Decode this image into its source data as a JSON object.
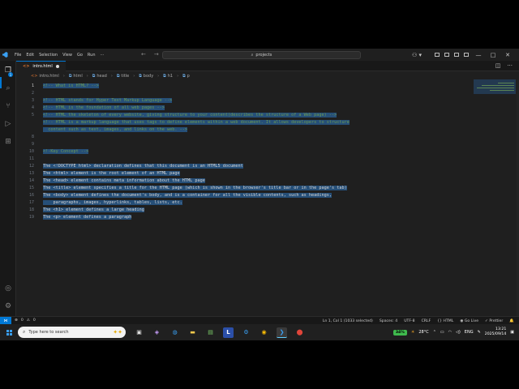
{
  "titlebar": {
    "menu": [
      "File",
      "Edit",
      "Selection",
      "View",
      "Go",
      "Run"
    ],
    "menu_more": "···",
    "search_text": "projects",
    "win_controls": [
      "—",
      "□",
      "✕"
    ]
  },
  "tab": {
    "filename": "intro.html",
    "icon_text": "<>"
  },
  "breadcrumb": [
    "intro.html",
    "html",
    "head",
    "title",
    "body",
    "h1",
    "p"
  ],
  "editor": {
    "lines": [
      {
        "n": "1",
        "sel": "<!-- What is HTML? -->",
        "rest": ""
      },
      {
        "n": "2",
        "sel": "",
        "rest": ""
      },
      {
        "n": "3",
        "sel": "<!-- HTML stands for Hyper Text Markup Language -->",
        "rest": ""
      },
      {
        "n": "4",
        "sel": "<!-- HTML is the foundation of all web pages -->",
        "rest": ""
      },
      {
        "n": "5",
        "sel": "<!-- HTML the skeleton of every website, giving structure to your content(describes the structure of a Web page) -->",
        "rest": ""
      },
      {
        "n": "",
        "sel": "<!-- HTML is a markup language that uses tags to define elements within a web document. It allows developers to structure",
        "rest": ""
      },
      {
        "n": "",
        "sel": "  content such as text, images, and links on the web. -->",
        "rest": ""
      },
      {
        "n": "8",
        "sel": "",
        "rest": ""
      },
      {
        "n": "9",
        "sel": "",
        "rest": ""
      },
      {
        "n": "10",
        "sel": "<!-Key Concept -->",
        "rest": ""
      },
      {
        "n": "11",
        "sel": "",
        "rest": ""
      },
      {
        "n": "12",
        "sel": "The <!DOCTYPE html> declaration defines that this document is an HTML5 document",
        "rest": ""
      },
      {
        "n": "13",
        "sel": "The <html> element is the root element of an HTML page",
        "rest": ""
      },
      {
        "n": "14",
        "sel": "The <head> element contains meta information about the HTML page",
        "rest": ""
      },
      {
        "n": "15",
        "sel": "The <title> element specifies a title for the HTML page (which is shown in the browser's title bar or in the page's tab)",
        "rest": ""
      },
      {
        "n": "16",
        "sel": "The <body> element defines the document's body, and is a container for all the visible contents, such as headings,",
        "rest": ""
      },
      {
        "n": "17",
        "sel": "    paragraphs, images, hyperlinks, tables, lists, etc.",
        "rest": ""
      },
      {
        "n": "18",
        "sel": "The <h1> element defines a large heading",
        "rest": ""
      },
      {
        "n": "19",
        "sel": "The <p> element defines a paragraph",
        "rest": ""
      }
    ]
  },
  "statusbar": {
    "errors": "0",
    "warnings": "0",
    "position": "Ln 1, Col 1 (1033 selected)",
    "spaces": "Spaces: 4",
    "encoding": "UTF-8",
    "eol": "CRLF",
    "language": "HTML",
    "golive": "Go Live",
    "prettier": "Prettier"
  },
  "taskbar": {
    "search_placeholder": "Type here to search",
    "battery": "34%",
    "weather": "28°C",
    "lang": "ENG",
    "time": "13:21",
    "date": "2025/09/14"
  },
  "colors": {
    "accent": "#0078d4",
    "selection": "#264f78",
    "comment": "#6a9955",
    "editor_bg": "#1f1f1f"
  }
}
